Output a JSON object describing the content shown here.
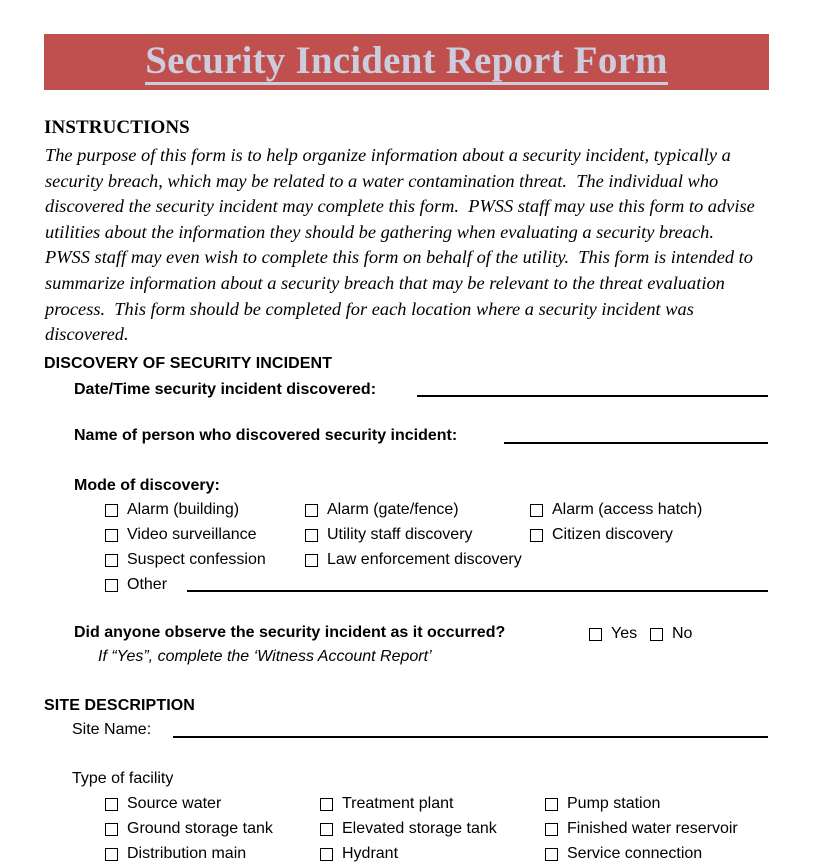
{
  "document": {
    "title": "Security Incident Report Form",
    "banner_color": "#c0504d",
    "banner_text_color": "#ccccdd"
  },
  "instructions": {
    "heading": "INSTRUCTIONS",
    "body": "The purpose of this form is to help organize information about a security incident, typically a security breach, which may be related to a water contamination threat.  The individual who discovered the security incident may complete this form.  PWSS staff may use this form to advise utilities about the information they should be gathering when evaluating a security breach.  PWSS staff may even wish to complete this form on behalf of the utility.  This form is intended to summarize information about a security breach that may be relevant to the threat evaluation process.  This form should be completed for each location where a security incident was discovered."
  },
  "discovery_section": {
    "heading": "DISCOVERY OF SECURITY INCIDENT",
    "datetime_label": "Date/Time security incident discovered:",
    "datetime_value": "",
    "name_label": "Name of person who discovered security incident:",
    "name_value": "",
    "mode_label": "Mode of discovery:",
    "mode_options": [
      "Alarm (building)",
      "Alarm (gate/fence)",
      "Alarm (access hatch)",
      "Video surveillance",
      "Utility staff discovery",
      "Citizen discovery",
      "Suspect confession",
      "Law enforcement discovery",
      "Other"
    ],
    "other_value": "",
    "observe_question": "Did anyone observe the security incident as it occurred?",
    "observe_yes": "Yes",
    "observe_no": "No",
    "observe_note": "If “Yes”, complete the ‘Witness Account Report’"
  },
  "site_section": {
    "heading": "SITE DESCRIPTION",
    "site_name_label": "Site Name:",
    "site_name_value": "",
    "facility_label": "Type of facility",
    "facility_options": [
      "Source water",
      "Treatment plant",
      "Pump station",
      "Ground storage tank",
      "Elevated storage tank",
      "Finished water reservoir",
      "Distribution main",
      "Hydrant",
      "Service connection"
    ]
  }
}
